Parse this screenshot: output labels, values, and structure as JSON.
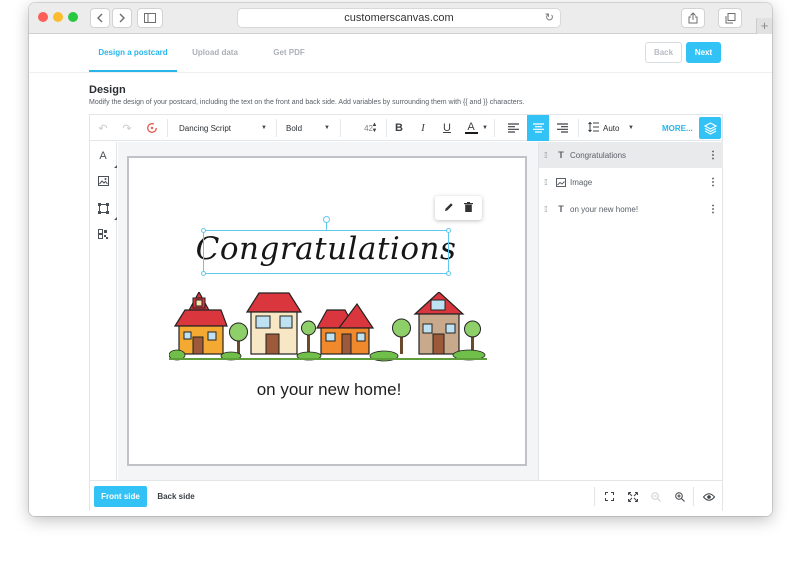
{
  "browser": {
    "url": "customerscanvas.com",
    "nav_back_icon": "chevron-left-icon",
    "nav_forward_icon": "chevron-right-icon",
    "sidebar_icon": "sidebar-icon",
    "reload_icon": "reload-icon",
    "share_icon": "share-icon",
    "tabs_icon": "tabs-icon",
    "new_tab_label": "+"
  },
  "steps": [
    {
      "label": "Design a postcard",
      "active": true
    },
    {
      "label": "Upload data",
      "active": false
    },
    {
      "label": "Get PDF",
      "active": false
    }
  ],
  "nav_buttons": {
    "back": "Back",
    "next": "Next"
  },
  "section": {
    "title": "Design",
    "description": "Modify the design of your postcard, including the text on the front and back side. Add variables by surrounding them with {{ and }} characters."
  },
  "toolbar": {
    "undo_icon": "undo-icon",
    "redo_icon": "redo-icon",
    "reset_icon": "reset-icon",
    "font_family": "Dancing Script",
    "font_weight": "Bold",
    "font_size": "42",
    "bold": "B",
    "italic": "I",
    "underline": "U",
    "text_color_label": "A",
    "text_color": "#1a1a1a",
    "align_left_icon": "align-left-icon",
    "align_center_icon": "align-center-icon",
    "align_right_icon": "align-right-icon",
    "line_height": "Auto",
    "more": "MORE...",
    "layers_icon": "layers-icon"
  },
  "left_tools": [
    {
      "name": "text-tool",
      "label": "A"
    },
    {
      "name": "image-tool",
      "icon": "image-icon"
    },
    {
      "name": "shape-tool",
      "icon": "shape-icon"
    },
    {
      "name": "barcode-tool",
      "icon": "qr-code-icon"
    }
  ],
  "canvas": {
    "headline": "Congratulations",
    "subtitle": "on your new home!",
    "edit_icon": "pencil-icon",
    "delete_icon": "trash-icon"
  },
  "layers": [
    {
      "type": "T",
      "name": "Congratulations",
      "selected": true
    },
    {
      "type": "image",
      "name": "Image",
      "selected": false
    },
    {
      "type": "T",
      "name": "on your new home!",
      "selected": false
    }
  ],
  "bottom": {
    "front_side": "Front side",
    "back_side": "Back side",
    "fit_icon": "fit-icon",
    "fullscreen_icon": "fullscreen-icon",
    "zoom_out_icon": "zoom-out-icon",
    "zoom_in_icon": "zoom-in-icon",
    "preview_icon": "eye-icon"
  },
  "colors": {
    "accent": "#33c2f5",
    "roof_red": "#d9363e",
    "house_orange": "#f0892c"
  }
}
